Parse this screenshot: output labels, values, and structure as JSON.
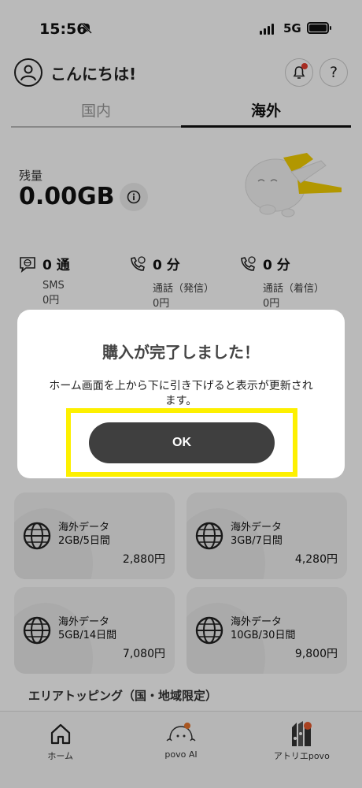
{
  "status_bar": {
    "time": "15:56",
    "network": "5G"
  },
  "header": {
    "greeting": "こんにちは!",
    "help_label": "?"
  },
  "tabs": [
    {
      "label": "国内",
      "active": false
    },
    {
      "label": "海外",
      "active": true
    }
  ],
  "data": {
    "remaining_label": "残量",
    "remaining_value": "0.00GB"
  },
  "stats": [
    {
      "icon": "globe-chat-icon",
      "count": "0 通",
      "name": "SMS",
      "price": "0円"
    },
    {
      "icon": "globe-phone-icon",
      "count": "0 分",
      "name": "通話（発信）",
      "price": "0円"
    },
    {
      "icon": "globe-phone-icon",
      "count": "0 分",
      "name": "通話（着信）",
      "price": "0円"
    }
  ],
  "cards": [
    {
      "line1": "海外データ",
      "line2": "2GB/5日間",
      "price": "2,880円"
    },
    {
      "line1": "海外データ",
      "line2": "3GB/7日間",
      "price": "4,280円"
    },
    {
      "line1": "海外データ",
      "line2": "5GB/14日間",
      "price": "7,080円"
    },
    {
      "line1": "海外データ",
      "line2": "10GB/30日間",
      "price": "9,800円"
    }
  ],
  "topping_title": "エリアトッピング（国・地域限定）",
  "nav": [
    {
      "label": "ホーム"
    },
    {
      "label": "povo AI"
    },
    {
      "label": "アトリエpovo"
    }
  ],
  "modal": {
    "title": "購入が完了しました！",
    "message": "ホーム画面を上から下に引き下げると表示が更新されます。",
    "ok_label": "OK"
  },
  "colors": {
    "highlight": "#fdf000",
    "button": "#3f3f3f",
    "accent": "#f5d000"
  }
}
